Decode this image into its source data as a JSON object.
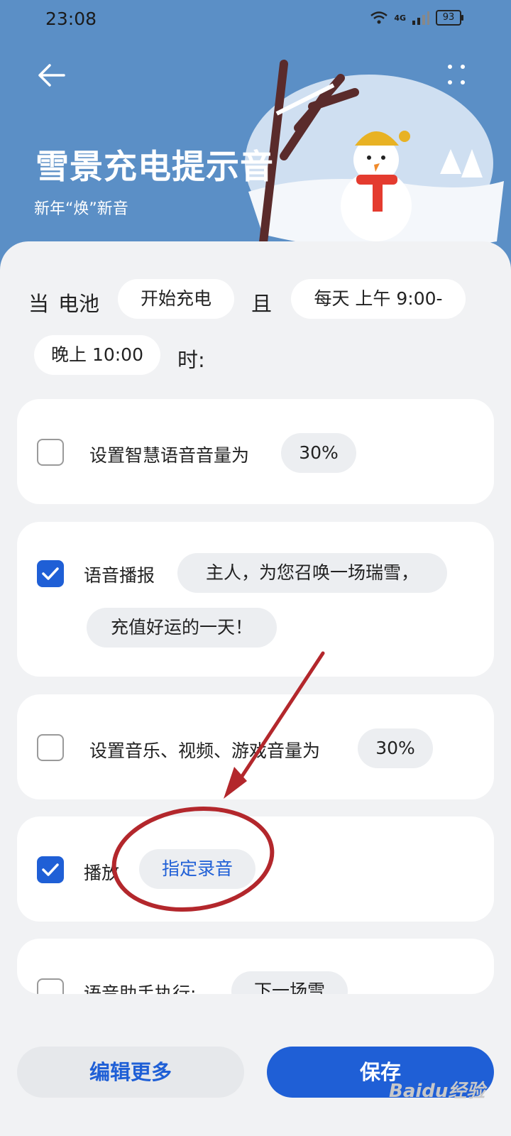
{
  "status_bar": {
    "time": "23:08",
    "network": "4G",
    "battery": "93"
  },
  "header": {
    "title": "雪景充电提示音",
    "subtitle": "新年“焕”新音",
    "icons": {
      "back": "back-arrow-icon",
      "more": "more-dots-icon"
    }
  },
  "condition": {
    "when": "当",
    "battery": "电池",
    "battery_state": "开始充电",
    "and": "且",
    "time_range_start": "每天 上午 9:00-",
    "time_range_end": "晚上 10:00",
    "suffix": "时:"
  },
  "actions": [
    {
      "checked": false,
      "label": "设置智慧语音音量为",
      "value": "30%"
    },
    {
      "checked": true,
      "label": "语音播报",
      "value_line1": "主人，为您召唤一场瑞雪，",
      "value_line2": "充值好运的一天！"
    },
    {
      "checked": false,
      "label": "设置音乐、视频、游戏音量为",
      "value": "30%"
    },
    {
      "checked": true,
      "label": "播放",
      "value": "指定录音"
    },
    {
      "checked": false,
      "label": "语音助手执行:",
      "value": "下一场雪"
    }
  ],
  "footer": {
    "edit_more": "编辑更多",
    "save": "保存"
  },
  "watermark": "Baidu经验",
  "colors": {
    "accent": "#1f5fd6",
    "header_bg": "#5b8fc6",
    "annotation": "#b3272c"
  }
}
